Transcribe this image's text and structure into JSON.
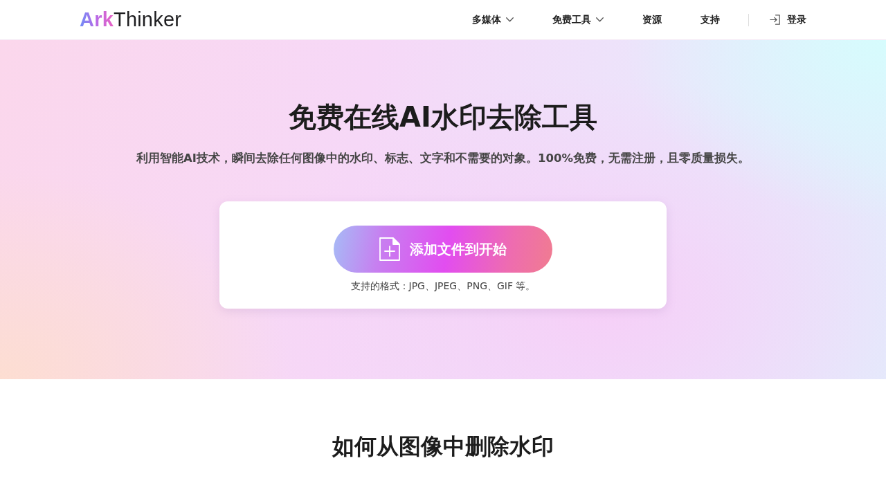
{
  "header": {
    "logo": {
      "accent": "Ark",
      "rest": "Thinker"
    },
    "nav": [
      {
        "label": "多媒体",
        "has_menu": true
      },
      {
        "label": "免费工具",
        "has_menu": true
      },
      {
        "label": "资源",
        "has_menu": false
      },
      {
        "label": "支持",
        "has_menu": false
      }
    ],
    "login": {
      "label": "登录"
    }
  },
  "hero": {
    "title": "免费在线AI水印去除工具",
    "subtitle": "利用智能AI技术，瞬间去除任何图像中的水印、标志、文字和不需要的对象。100%免费，无需注册，且零质量损失。",
    "upload": {
      "button": "添加文件到开始",
      "formats": "支持的格式：JPG、JPEG、PNG、GIF 等。"
    }
  },
  "how_to": {
    "title": "如何从图像中删除水印"
  }
}
